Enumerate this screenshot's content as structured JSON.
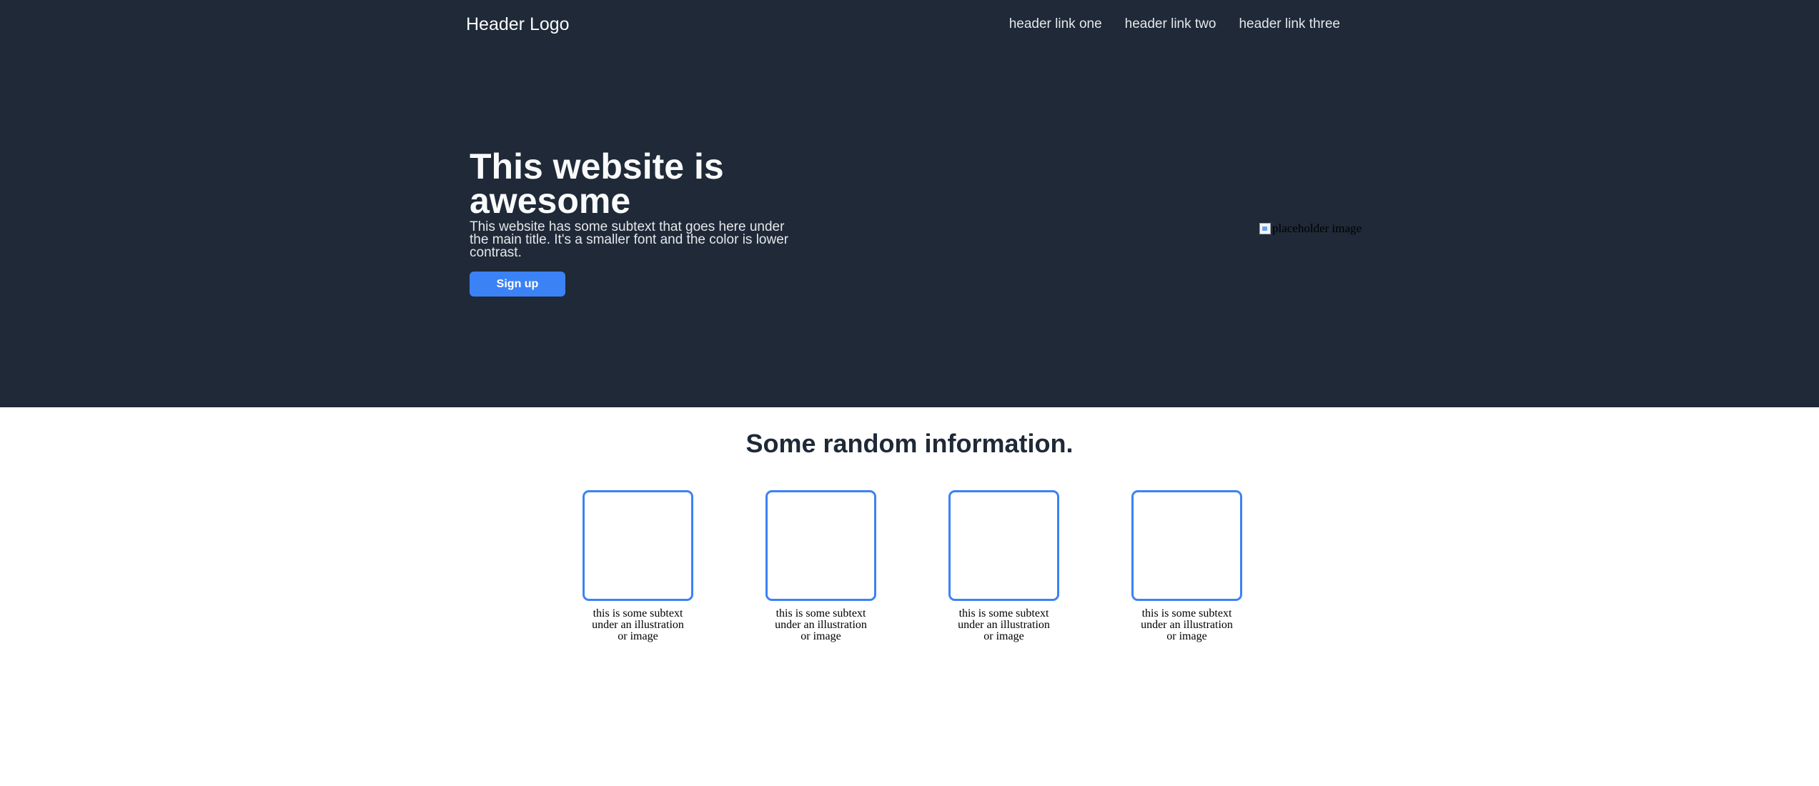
{
  "header": {
    "logo": "Header Logo",
    "links": [
      "header link one",
      "header link two",
      "header link three"
    ]
  },
  "hero": {
    "title": "This website is awesome",
    "subtitle": "This website has some subtext that goes here under the main title. It's a smaller font and the color is lower contrast.",
    "button_label": "Sign up",
    "image_alt": "placeholder image",
    "image_icon": "broken-image-icon"
  },
  "info": {
    "title": "Some random information.",
    "cards": [
      {
        "caption": "this is some subtext under an illustration or image"
      },
      {
        "caption": "this is some subtext under an illustration or image"
      },
      {
        "caption": "this is some subtext under an illustration or image"
      },
      {
        "caption": "this is some subtext under an illustration or image"
      }
    ]
  },
  "colors": {
    "hero_background": "#1f2937",
    "accent": "#3b82f6",
    "page_background": "#ffffff"
  }
}
